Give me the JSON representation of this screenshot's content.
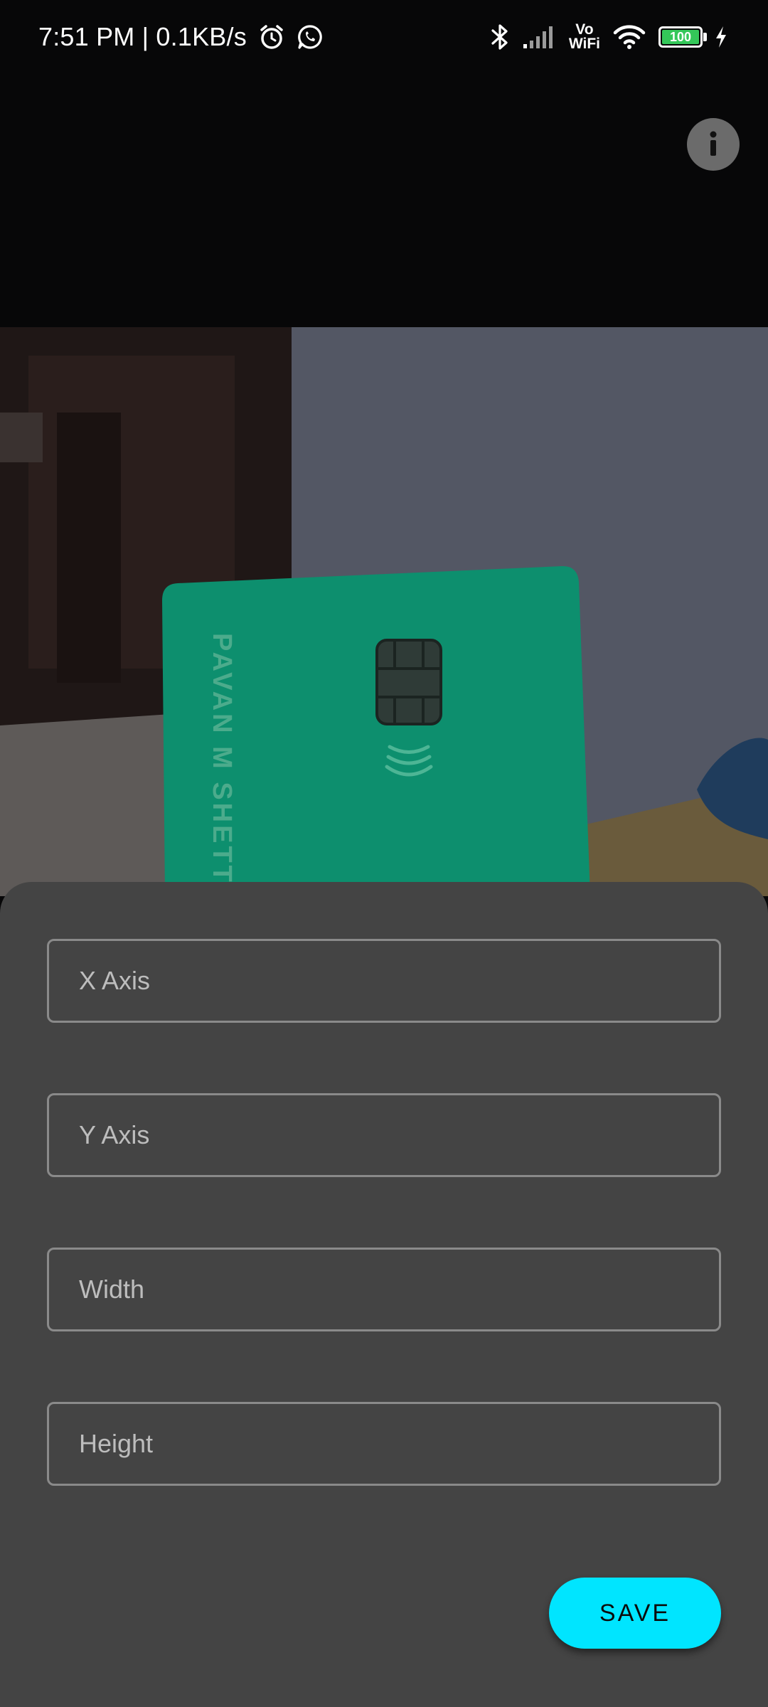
{
  "status_bar": {
    "time_speed": "7:51 PM | 0.1KB/s",
    "left_icons": [
      "alarm-icon",
      "whatsapp-icon"
    ],
    "right_icons": [
      "bluetooth-icon",
      "signal-icon",
      "vowifi-icon",
      "wifi-icon",
      "battery-icon",
      "charging-icon"
    ],
    "vowifi_top": "Vo",
    "vowifi_bottom": "WiFi",
    "battery_level": "100",
    "battery_color": "#34c759"
  },
  "toolbar": {
    "info_icon": "info-icon"
  },
  "camera_preview": {
    "card_name_text": "PAVAN M SHETTY",
    "card_color": "#0d8f6e"
  },
  "form": {
    "x_axis": {
      "placeholder": "X Axis",
      "value": ""
    },
    "y_axis": {
      "placeholder": "Y Axis",
      "value": ""
    },
    "width": {
      "placeholder": "Width",
      "value": ""
    },
    "height": {
      "placeholder": "Height",
      "value": ""
    },
    "save_label": "SAVE"
  },
  "colors": {
    "accent": "#00e5ff",
    "sheet_background": "#444444",
    "field_border": "#8a8a8a"
  }
}
